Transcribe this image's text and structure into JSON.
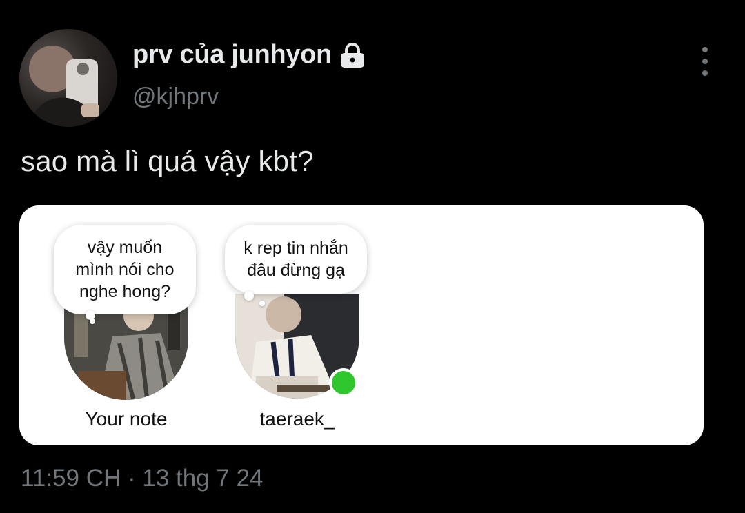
{
  "header": {
    "display_name": "prv của junhyon",
    "handle": "@kjhprv"
  },
  "tweet": {
    "text": "sao mà lì quá vậy kbt?",
    "timestamp": "11:59 CH · 13 thg 7 24"
  },
  "card": {
    "notes": [
      {
        "text": "vậy muốn\nmình nói cho\nnghe hong?",
        "label": "Your note"
      },
      {
        "text": "k rep tin nhắn\nđâu đừng gạ",
        "label": "taeraek_"
      }
    ]
  },
  "colors": {
    "background": "#000000",
    "primary_text": "#e7e9ea",
    "secondary_text": "#71767b",
    "online": "#2fc72d"
  }
}
